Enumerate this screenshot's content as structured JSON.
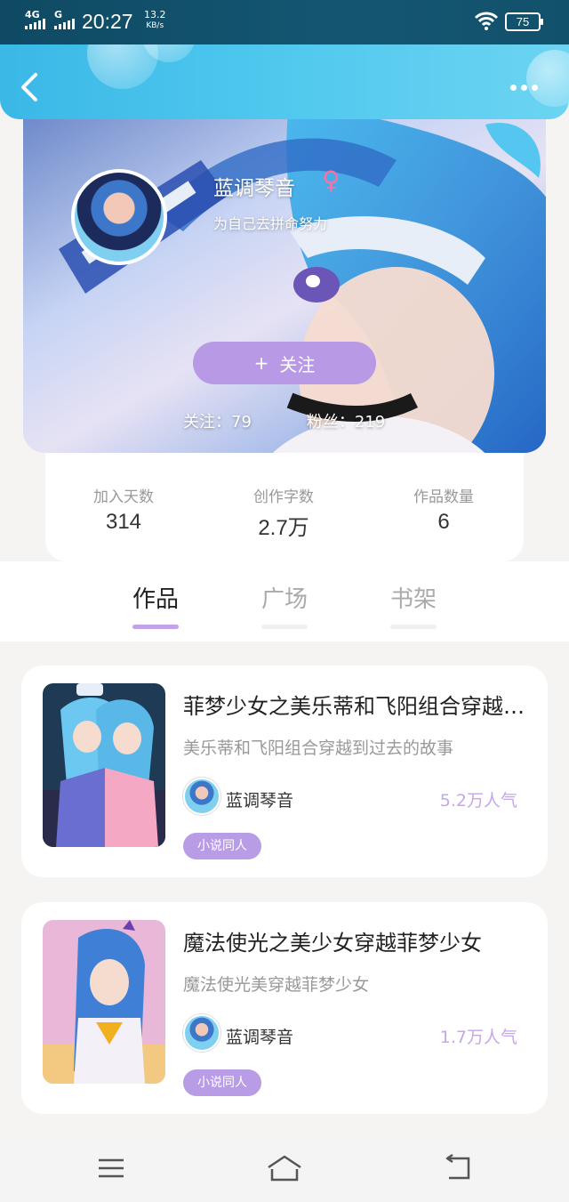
{
  "status_bar": {
    "network_1": "4G",
    "network_2": "G",
    "time": "20:27",
    "speed_value": "13.2",
    "speed_unit": "KB/s",
    "battery": "75"
  },
  "header": {
    "back_icon": "chevron-left-icon",
    "more_icon": "more-dots-icon"
  },
  "profile": {
    "name": "蓝调琴音",
    "gender_symbol": "♀",
    "bio": "为自己去拼命努力",
    "follow_button": {
      "icon": "+",
      "label": "关注"
    },
    "following": "关注：79",
    "followers": "粉丝：219"
  },
  "stats": [
    {
      "label": "加入天数",
      "value": "314"
    },
    {
      "label": "创作字数",
      "value": "2.7万"
    },
    {
      "label": "作品数量",
      "value": "6"
    }
  ],
  "tabs": [
    {
      "label": "作品",
      "active": true
    },
    {
      "label": "广场",
      "active": false
    },
    {
      "label": "书架",
      "active": false
    }
  ],
  "works": [
    {
      "title": "菲梦少女之美乐蒂和飞阳组合穿越到过去",
      "description": "美乐蒂和飞阳组合穿越到过去的故事",
      "author": "蓝调琴音",
      "popularity": "5.2万人气",
      "tag": "小说同人"
    },
    {
      "title": "魔法使光之美少女穿越菲梦少女",
      "description": "魔法使光美穿越菲梦少女",
      "author": "蓝调琴音",
      "popularity": "1.7万人气",
      "tag": "小说同人"
    }
  ],
  "navbar": {
    "menu_icon": "menu-icon",
    "home_icon": "home-icon",
    "back_icon": "return-icon"
  },
  "colors": {
    "accent_purple": "#b799e6",
    "header_blue": "#3ab8e6",
    "popularity": "#c6a6ec"
  }
}
